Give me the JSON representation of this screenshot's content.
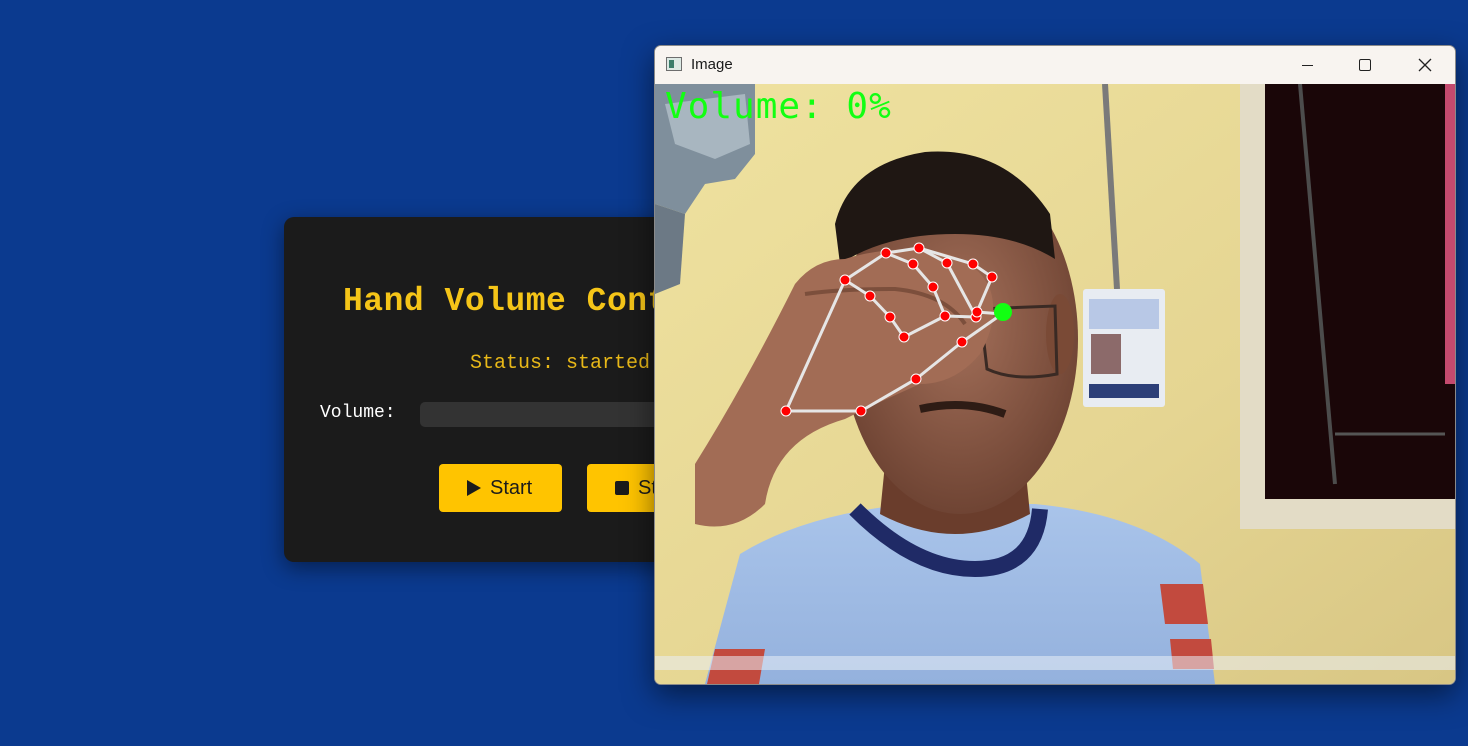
{
  "app": {
    "title": "Hand Volume Control",
    "status": "Status: started",
    "volume_label": "Volume:",
    "volume_fraction": 0,
    "buttons": {
      "start": "Start",
      "stop": "Stop"
    },
    "accent_color": "#f5c518"
  },
  "cv_window": {
    "title": "Image",
    "overlay_text": "Volume: 0%",
    "overlay_color": "#12ff12",
    "landmark_color": "#ff0000",
    "connection_color": "#e6e6e6"
  },
  "background_color": "#0b3a8f"
}
